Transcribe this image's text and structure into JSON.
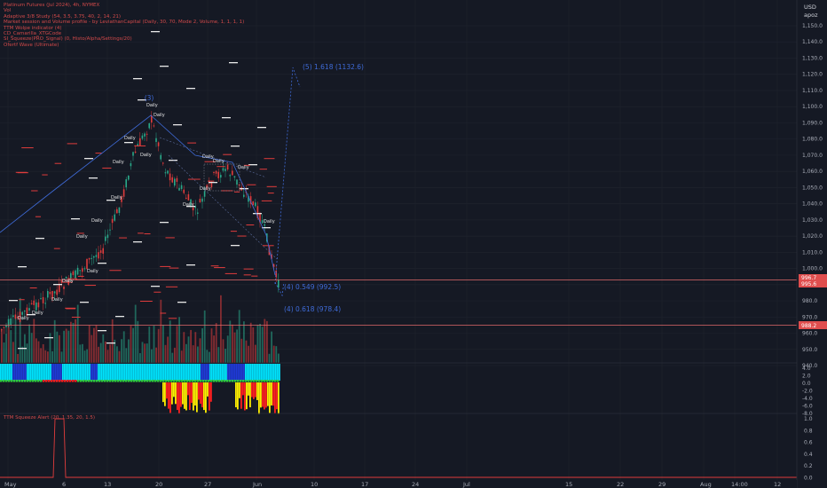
{
  "legend": {
    "lines": [
      "Platinum Futures (Jul 2024), 4h, NYMEX",
      "Vol",
      "Adaptive 3/8 Study (54, 3.5, 3.75, 40, 2, 14, 21)",
      "Market session and Volume profile - by LeviathanCapital (Daily, 30, 70, Mode 2, Volume, 1, 1, 1, 1)",
      "TTM Wolpe indicator (4)",
      "CD_Camarilla_XTGCode",
      "SI_Squeeze(PRO_Signal) (0, Histo/Alpha/Settings/20)",
      "Ofertf Wave (Ultimate)"
    ],
    "ttm_label": "TTM Squeeze Alert (20, 1.35, 20, 1.5)"
  },
  "header": {
    "currency": "USD",
    "mode": "apoz"
  },
  "price_axis": {
    "ticks": [
      "1,150.0",
      "1,140.0",
      "1,130.0",
      "1,120.0",
      "1,110.0",
      "1,100.0",
      "1,090.0",
      "1,080.0",
      "1,070.0",
      "1,060.0",
      "1,050.0",
      "1,040.0",
      "1,030.0",
      "1,020.0",
      "1,010.0",
      "1,000.0",
      "990.0",
      "980.0",
      "970.0",
      "960.0",
      "950.0",
      "940.0"
    ],
    "last_price_badge": "996.7",
    "last_price_sub": "995.6",
    "level_badge": "988.2"
  },
  "osc_axis": {
    "ticks": [
      "4.0",
      "2.0",
      "0.0",
      "-2.0",
      "-4.0",
      "-6.0",
      "-8.0"
    ]
  },
  "ttm_axis": {
    "ticks": [
      "1.0",
      "0.8",
      "0.6",
      "0.4",
      "0.2",
      "0.0"
    ]
  },
  "time_axis": {
    "ticks": [
      "May",
      "6",
      "13",
      "20",
      "27",
      "Jun",
      "10",
      "17",
      "24",
      "Jul",
      "15",
      "22",
      "29",
      "Aug",
      "14:00",
      "12"
    ]
  },
  "annotations": {
    "wave3": "(3)",
    "fib_target": "(5) 1.618 (1132.6)",
    "fib_549": "(4) 0.549 (992.5)",
    "fib_618": "(4) 0.618 (978.4)",
    "daily_tag": "Daily"
  },
  "colors": {
    "background": "#151924",
    "up": "#2aa889",
    "down": "#e03c3c",
    "fib_blue": "#3f6bd8",
    "badge_red": "#e04e4e",
    "squeeze_cyan": "#00e5ff",
    "squeeze_blue": "#1f3ad8",
    "osc_red": "#ff1f1f",
    "osc_yellow": "#ffee00",
    "osc_green": "#2ecc40"
  }
}
